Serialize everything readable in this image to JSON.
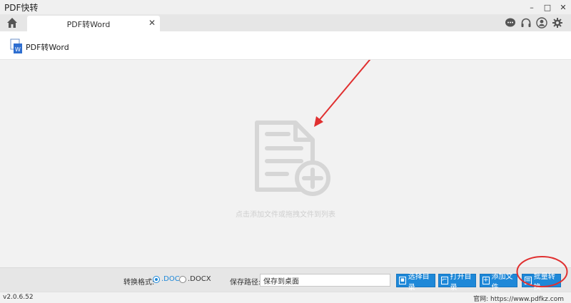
{
  "window": {
    "title": "PDF快转",
    "minimize": "–",
    "maximize": "□",
    "close": "✕"
  },
  "tabs": [
    {
      "label": "PDF转Word",
      "close": "✕"
    }
  ],
  "tool": {
    "name": "PDF转Word"
  },
  "drop_area": {
    "hint": "点击添加文件或拖拽文件到列表"
  },
  "bottom": {
    "format_label": "转换格式:",
    "formats": [
      {
        "label": ".DOC",
        "selected": true
      },
      {
        "label": ".DOCX",
        "selected": false
      }
    ],
    "path_label": "保存路径:",
    "path_value": "保存到桌面",
    "buttons": {
      "select_dir": "选择目录",
      "open_dir": "打开目录",
      "add_file": "添加文件",
      "batch_convert": "批量转换"
    }
  },
  "status": {
    "version": "v2.0.6.52",
    "site_label": "官网:",
    "site_url": "https://www.pdfkz.com"
  },
  "colors": {
    "accent": "#1e88d8",
    "annotation": "#e03030"
  }
}
